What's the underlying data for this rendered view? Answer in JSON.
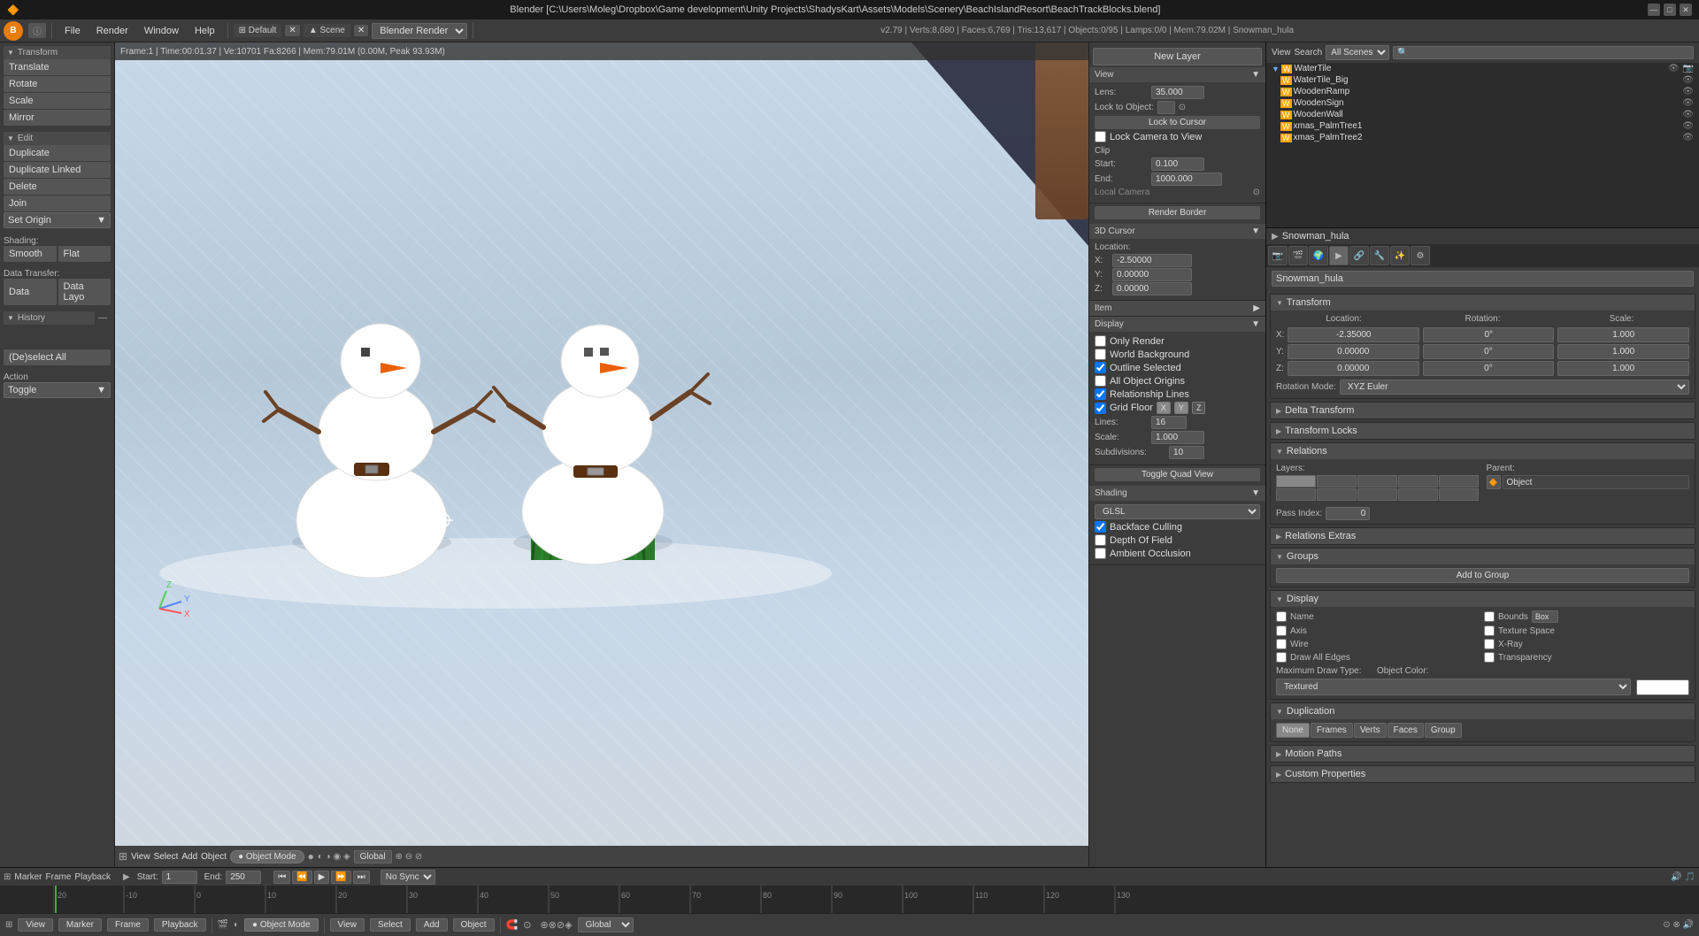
{
  "titlebar": {
    "title": "Blender [C:\\Users\\Moleg\\Dropbox\\Game development\\Unity Projects\\ShadysKart\\Assets\\Models\\Scenery\\BeachIslandResort\\BeachTrackBlocks.blend]",
    "minimize": "—",
    "maximize": "□",
    "close": "✕"
  },
  "menubar": {
    "logo": "B",
    "info_label": "ⓘ",
    "menu_items": [
      "File",
      "Render",
      "Window",
      "Help"
    ],
    "layout": "Default",
    "scene": "Scene",
    "engine": "Blender Render",
    "version": "v2.79 | Verts:8,680 | Faces:6,769 | Tris:13,617 | Objects:0/95 | Lamps:0/0 | Mem:79.02M | Snowman_hula"
  },
  "viewport_header": {
    "frame": "Frame:1 | Time:00:01.37 | Ve:10701 Fa:8266 | Mem:79.01M (0.00M, Peak 93.93M)"
  },
  "left_toolbar": {
    "transform_header": "Transform",
    "translate": "Translate",
    "rotate": "Rotate",
    "scale": "Scale",
    "mirror": "Mirror",
    "edit_header": "Edit",
    "duplicate": "Duplicate",
    "duplicate_linked": "Duplicate Linked",
    "delete": "Delete",
    "join": "Join",
    "set_origin": "Set Origin",
    "shading_label": "Shading:",
    "smooth": "Smooth",
    "flat": "Flat",
    "data_transfer_label": "Data Transfer:",
    "data": "Data",
    "data_layo": "Data Layo",
    "history_header": "History",
    "deselect_all": "(De)select All",
    "action_label": "Action",
    "toggle": "Toggle"
  },
  "right_panel": {
    "new_layer_btn": "New Layer",
    "view_header": "View",
    "lens_label": "Lens:",
    "lens_value": "35.000",
    "lock_to_object_label": "Lock to Object:",
    "lock_to_cursor_btn": "Lock to Cursor",
    "lock_camera_btn": "Lock Camera to View",
    "clip_label": "Clip",
    "start_label": "Start:",
    "start_value": "0.100",
    "end_label": "End:",
    "end_value": "1000.000",
    "local_camera_label": "Local Camera",
    "render_border_btn": "Render Border",
    "cursor_3d_header": "3D Cursor",
    "location_label": "Location:",
    "cursor_x_label": "X:",
    "cursor_x_value": "-2.50000",
    "cursor_y_label": "Y:",
    "cursor_y_value": "0.00000",
    "cursor_z_label": "Z:",
    "cursor_z_value": "0.00000",
    "item_header": "Item",
    "display_header": "Display",
    "only_render": "Only Render",
    "world_background": "World Background",
    "outline_selected": "Outline Selected",
    "all_object_origins": "All Object Origins",
    "relationship_lines": "Relationship Lines",
    "grid_floor": "Grid Floor",
    "grid_x": "X",
    "grid_y": "Y",
    "grid_z": "Z",
    "lines_label": "Lines:",
    "lines_value": "16",
    "scale_label": "Scale:",
    "scale_value": "1.000",
    "subdivisions_label": "Subdivisions:",
    "subdivisions_value": "10",
    "toggle_quad_btn": "Toggle Quad View",
    "shading_header": "Shading",
    "glsl_label": "GLSL",
    "backface_culling": "Backface Culling",
    "depth_of_field": "Depth Of Field",
    "ambient_occlusion": "Ambient Occlusion"
  },
  "outliner": {
    "header": "All Scenes",
    "items": [
      {
        "name": "WaterTile",
        "icon": "▼",
        "type": "mesh"
      },
      {
        "name": "WaterTile_Big",
        "icon": "▼",
        "type": "mesh"
      },
      {
        "name": "WoodenRamp",
        "icon": "▼",
        "type": "mesh"
      },
      {
        "name": "WoodenSign",
        "icon": "▼",
        "type": "mesh"
      },
      {
        "name": "WoodenWall",
        "icon": "▼",
        "type": "mesh"
      },
      {
        "name": "xmas_PalmTree1",
        "icon": "▼",
        "type": "mesh"
      },
      {
        "name": "xmas_PalmTree2",
        "icon": "▼",
        "type": "mesh"
      }
    ]
  },
  "properties": {
    "active_object": "Snowman_hula",
    "active_mesh": "Snowman_hula",
    "transform": {
      "header": "Transform",
      "location_label": "Location:",
      "rotation_label": "Rotation:",
      "scale_label": "Scale:",
      "loc_x": "-2.35000",
      "loc_y": "0.00000",
      "loc_z": "0.00000",
      "rot_x": "0°",
      "rot_y": "0°",
      "rot_z": "0°",
      "sca_x": "1.000",
      "sca_y": "1.000",
      "sca_z": "1.000",
      "rotation_mode_label": "Rotation Mode:",
      "rotation_mode": "XYZ Euler"
    },
    "delta_transform": {
      "header": "Delta Transform"
    },
    "transform_locks": {
      "header": "Transform Locks"
    },
    "relations": {
      "header": "Relations",
      "layers_label": "Layers:",
      "parent_label": "Parent:",
      "pass_index_label": "Pass Index:",
      "pass_index_value": "0",
      "parent_value": "Object"
    },
    "relations_extras": {
      "header": "Relations Extras"
    },
    "groups": {
      "header": "Groups",
      "add_to_group_btn": "Add to Group"
    },
    "display": {
      "header": "Display",
      "name_label": "Name",
      "axis_label": "Axis",
      "wire_label": "Wire",
      "all_edges_label": "Draw All Edges",
      "bounds_label": "Bounds",
      "box_label": "Box",
      "texture_space_label": "Texture Space",
      "xray_label": "X-Ray",
      "transparency_label": "Transparency",
      "max_draw_label": "Maximum Draw Type:",
      "obj_color_label": "Object Color:",
      "textured_label": "Textured"
    },
    "duplication": {
      "header": "Duplication",
      "tabs": [
        "None",
        "Frames",
        "Verts",
        "Faces",
        "Group"
      ],
      "active_tab": "None"
    },
    "motion_paths": {
      "header": "Motion Paths"
    },
    "custom_properties": {
      "header": "Custom Properties"
    }
  },
  "timeline": {
    "marker_label": "Marker",
    "frame_label": "Frame",
    "playback_label": "Playback",
    "start_label": "Start:",
    "start_value": "1",
    "end_label": "End:",
    "end_value": "250",
    "current_frame": "1",
    "no_sync_label": "No Sync"
  },
  "statusbar": {
    "view_btn": "View",
    "marker_btn": "Marker",
    "frame_btn": "Frame",
    "playback_btn": "Playback",
    "mode_btn": "Object Mode",
    "view_btn2": "View",
    "add_btn": "Add",
    "object_btn": "Object",
    "global_btn": "Global"
  },
  "smooth_flat": {
    "smooth": "Smooth",
    "flat": "Flat"
  }
}
